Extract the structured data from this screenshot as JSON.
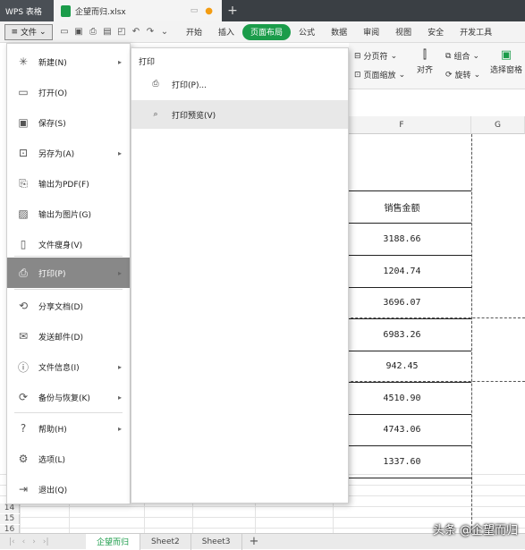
{
  "titlebar": {
    "app_label": "WPS 表格",
    "file_name": "企望而归.xlsx"
  },
  "ribbon": {
    "file_menu_label": "文件",
    "tabs": [
      "开始",
      "插入",
      "页面布局",
      "公式",
      "数据",
      "审阅",
      "视图",
      "安全",
      "开发工具"
    ],
    "active_tab": "页面布局"
  },
  "toolbar2": {
    "page_break": "分页符",
    "page_zoom": "页面缩放",
    "align": "对齐",
    "group": "组合",
    "rotate": "旋转",
    "select_pane": "选择窗格"
  },
  "sheet": {
    "columns": [
      "F",
      "G"
    ],
    "header_cell": "销售金额",
    "values": [
      "3188.66",
      "1204.74",
      "3696.07",
      "6983.26",
      "942.45",
      "4510.90",
      "4743.06",
      "1337.60"
    ],
    "row_numbers": [
      "14",
      "15",
      "16"
    ]
  },
  "sheet_tabs": [
    "企望而归",
    "Sheet2",
    "Sheet3"
  ],
  "active_sheet": "企望而归",
  "file_menu": {
    "items": [
      {
        "label": "新建(N)",
        "icon": "new-file-icon",
        "arrow": true
      },
      {
        "label": "打开(O)",
        "icon": "folder-open-icon",
        "arrow": false
      },
      {
        "label": "保存(S)",
        "icon": "save-icon",
        "arrow": false
      },
      {
        "label": "另存为(A)",
        "icon": "save-as-icon",
        "arrow": true
      },
      {
        "label": "输出为PDF(F)",
        "icon": "pdf-export-icon",
        "arrow": false
      },
      {
        "label": "输出为图片(G)",
        "icon": "image-export-icon",
        "arrow": false
      },
      {
        "label": "文件瘦身(V)",
        "icon": "slim-file-icon",
        "arrow": false
      },
      {
        "label": "打印(P)",
        "icon": "printer-icon",
        "arrow": true
      },
      {
        "label": "分享文档(D)",
        "icon": "share-icon",
        "arrow": false
      },
      {
        "label": "发送邮件(D)",
        "icon": "mail-icon",
        "arrow": false
      },
      {
        "label": "文件信息(I)",
        "icon": "file-info-icon",
        "arrow": true
      },
      {
        "label": "备份与恢复(K)",
        "icon": "backup-icon",
        "arrow": true
      },
      {
        "label": "帮助(H)",
        "icon": "help-icon",
        "arrow": true
      },
      {
        "label": "选项(L)",
        "icon": "settings-icon",
        "arrow": false
      },
      {
        "label": "退出(Q)",
        "icon": "exit-icon",
        "arrow": false
      }
    ],
    "active_item": "打印(P)"
  },
  "print_submenu": {
    "title": "打印",
    "items": [
      {
        "label": "打印(P)...",
        "icon": "printer-icon"
      },
      {
        "label": "打印预览(V)",
        "icon": "print-preview-icon"
      }
    ],
    "hover_item": "打印预览(V)"
  },
  "watermark": "头条 @企望而归",
  "colors": {
    "accent": "#1b9c4a",
    "titlebar": "#3a3f44",
    "active_menu": "#888888"
  }
}
